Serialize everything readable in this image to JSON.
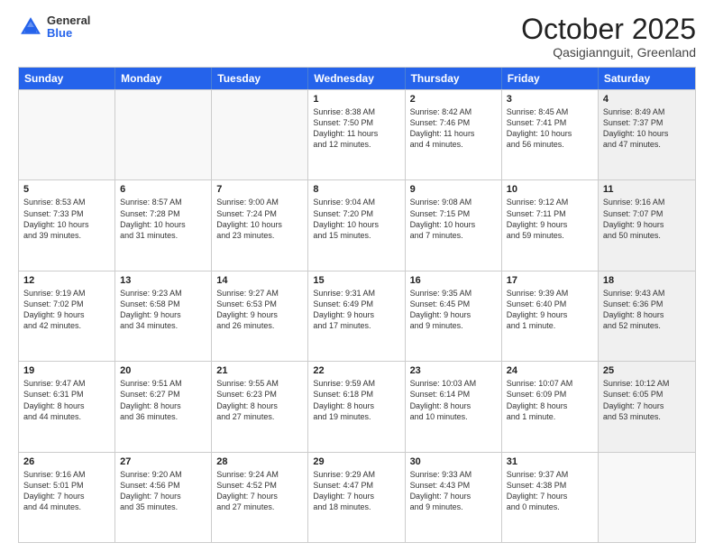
{
  "header": {
    "logo_general": "General",
    "logo_blue": "Blue",
    "month_title": "October 2025",
    "location": "Qasigiannguit, Greenland"
  },
  "calendar": {
    "days_of_week": [
      "Sunday",
      "Monday",
      "Tuesday",
      "Wednesday",
      "Thursday",
      "Friday",
      "Saturday"
    ],
    "weeks": [
      [
        {
          "day": "",
          "text": "",
          "empty": true
        },
        {
          "day": "",
          "text": "",
          "empty": true
        },
        {
          "day": "",
          "text": "",
          "empty": true
        },
        {
          "day": "1",
          "text": "Sunrise: 8:38 AM\nSunset: 7:50 PM\nDaylight: 11 hours\nand 12 minutes."
        },
        {
          "day": "2",
          "text": "Sunrise: 8:42 AM\nSunset: 7:46 PM\nDaylight: 11 hours\nand 4 minutes."
        },
        {
          "day": "3",
          "text": "Sunrise: 8:45 AM\nSunset: 7:41 PM\nDaylight: 10 hours\nand 56 minutes."
        },
        {
          "day": "4",
          "text": "Sunrise: 8:49 AM\nSunset: 7:37 PM\nDaylight: 10 hours\nand 47 minutes.",
          "shaded": true
        }
      ],
      [
        {
          "day": "5",
          "text": "Sunrise: 8:53 AM\nSunset: 7:33 PM\nDaylight: 10 hours\nand 39 minutes."
        },
        {
          "day": "6",
          "text": "Sunrise: 8:57 AM\nSunset: 7:28 PM\nDaylight: 10 hours\nand 31 minutes."
        },
        {
          "day": "7",
          "text": "Sunrise: 9:00 AM\nSunset: 7:24 PM\nDaylight: 10 hours\nand 23 minutes."
        },
        {
          "day": "8",
          "text": "Sunrise: 9:04 AM\nSunset: 7:20 PM\nDaylight: 10 hours\nand 15 minutes."
        },
        {
          "day": "9",
          "text": "Sunrise: 9:08 AM\nSunset: 7:15 PM\nDaylight: 10 hours\nand 7 minutes."
        },
        {
          "day": "10",
          "text": "Sunrise: 9:12 AM\nSunset: 7:11 PM\nDaylight: 9 hours\nand 59 minutes."
        },
        {
          "day": "11",
          "text": "Sunrise: 9:16 AM\nSunset: 7:07 PM\nDaylight: 9 hours\nand 50 minutes.",
          "shaded": true
        }
      ],
      [
        {
          "day": "12",
          "text": "Sunrise: 9:19 AM\nSunset: 7:02 PM\nDaylight: 9 hours\nand 42 minutes."
        },
        {
          "day": "13",
          "text": "Sunrise: 9:23 AM\nSunset: 6:58 PM\nDaylight: 9 hours\nand 34 minutes."
        },
        {
          "day": "14",
          "text": "Sunrise: 9:27 AM\nSunset: 6:53 PM\nDaylight: 9 hours\nand 26 minutes."
        },
        {
          "day": "15",
          "text": "Sunrise: 9:31 AM\nSunset: 6:49 PM\nDaylight: 9 hours\nand 17 minutes."
        },
        {
          "day": "16",
          "text": "Sunrise: 9:35 AM\nSunset: 6:45 PM\nDaylight: 9 hours\nand 9 minutes."
        },
        {
          "day": "17",
          "text": "Sunrise: 9:39 AM\nSunset: 6:40 PM\nDaylight: 9 hours\nand 1 minute."
        },
        {
          "day": "18",
          "text": "Sunrise: 9:43 AM\nSunset: 6:36 PM\nDaylight: 8 hours\nand 52 minutes.",
          "shaded": true
        }
      ],
      [
        {
          "day": "19",
          "text": "Sunrise: 9:47 AM\nSunset: 6:31 PM\nDaylight: 8 hours\nand 44 minutes."
        },
        {
          "day": "20",
          "text": "Sunrise: 9:51 AM\nSunset: 6:27 PM\nDaylight: 8 hours\nand 36 minutes."
        },
        {
          "day": "21",
          "text": "Sunrise: 9:55 AM\nSunset: 6:23 PM\nDaylight: 8 hours\nand 27 minutes."
        },
        {
          "day": "22",
          "text": "Sunrise: 9:59 AM\nSunset: 6:18 PM\nDaylight: 8 hours\nand 19 minutes."
        },
        {
          "day": "23",
          "text": "Sunrise: 10:03 AM\nSunset: 6:14 PM\nDaylight: 8 hours\nand 10 minutes."
        },
        {
          "day": "24",
          "text": "Sunrise: 10:07 AM\nSunset: 6:09 PM\nDaylight: 8 hours\nand 1 minute."
        },
        {
          "day": "25",
          "text": "Sunrise: 10:12 AM\nSunset: 6:05 PM\nDaylight: 7 hours\nand 53 minutes.",
          "shaded": true
        }
      ],
      [
        {
          "day": "26",
          "text": "Sunrise: 9:16 AM\nSunset: 5:01 PM\nDaylight: 7 hours\nand 44 minutes."
        },
        {
          "day": "27",
          "text": "Sunrise: 9:20 AM\nSunset: 4:56 PM\nDaylight: 7 hours\nand 35 minutes."
        },
        {
          "day": "28",
          "text": "Sunrise: 9:24 AM\nSunset: 4:52 PM\nDaylight: 7 hours\nand 27 minutes."
        },
        {
          "day": "29",
          "text": "Sunrise: 9:29 AM\nSunset: 4:47 PM\nDaylight: 7 hours\nand 18 minutes."
        },
        {
          "day": "30",
          "text": "Sunrise: 9:33 AM\nSunset: 4:43 PM\nDaylight: 7 hours\nand 9 minutes."
        },
        {
          "day": "31",
          "text": "Sunrise: 9:37 AM\nSunset: 4:38 PM\nDaylight: 7 hours\nand 0 minutes."
        },
        {
          "day": "",
          "text": "",
          "empty": true,
          "shaded": true
        }
      ]
    ]
  }
}
